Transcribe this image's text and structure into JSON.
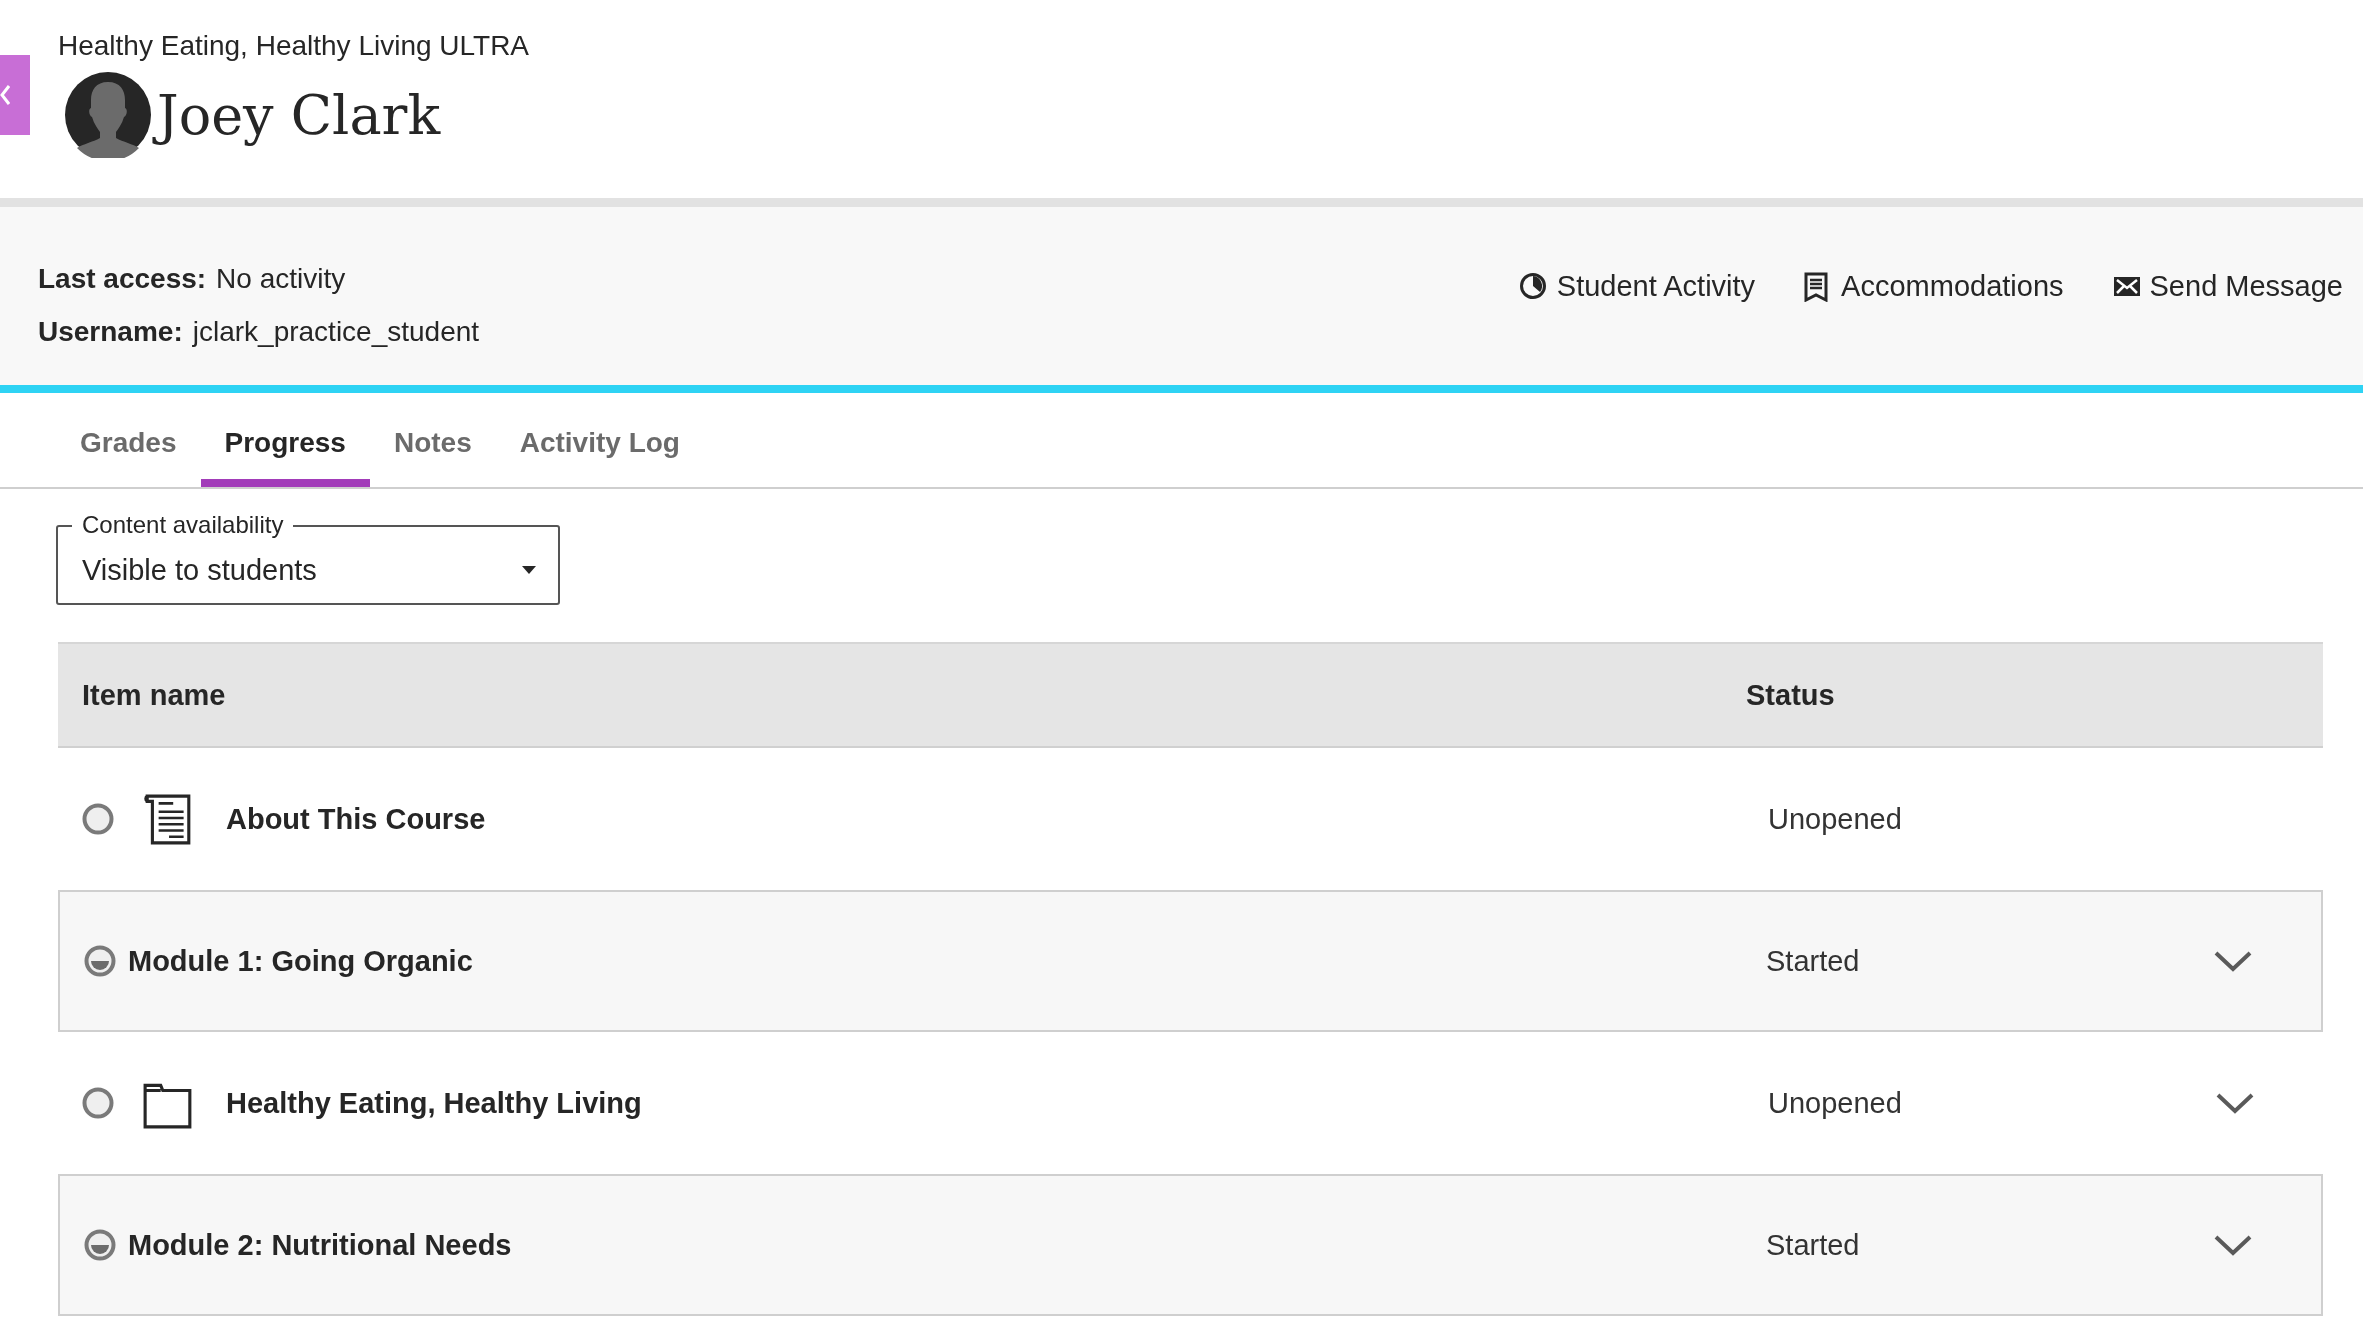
{
  "header": {
    "course_title": "Healthy Eating, Healthy Living ULTRA",
    "student_name": "Joey Clark"
  },
  "info": {
    "fields": [
      {
        "label": "Last access:",
        "value": "No activity"
      },
      {
        "label": "Username:",
        "value": "jclark_practice_student"
      }
    ],
    "actions": [
      {
        "kind": "activity",
        "label": "Student Activity"
      },
      {
        "kind": "accommodations",
        "label": "Accommodations"
      },
      {
        "kind": "message",
        "label": "Send Message"
      }
    ]
  },
  "tabs": [
    {
      "label": "Grades",
      "selected": false
    },
    {
      "label": "Progress",
      "selected": true
    },
    {
      "label": "Notes",
      "selected": false
    },
    {
      "label": "Activity Log",
      "selected": false
    }
  ],
  "filter": {
    "label": "Content availability",
    "value": "Visible to students"
  },
  "table": {
    "columns": [
      "Item name",
      "Status"
    ],
    "rows": [
      {
        "kind": "document",
        "started": false,
        "name": "About This Course",
        "status": "Unopened",
        "expandable": false
      },
      {
        "kind": "module",
        "started": true,
        "name": "Module 1: Going Organic",
        "status": "Started",
        "expandable": true
      },
      {
        "kind": "folder",
        "started": false,
        "name": "Healthy Eating, Healthy Living",
        "status": "Unopened",
        "expandable": true
      },
      {
        "kind": "module",
        "started": true,
        "name": "Module 2: Nutritional Needs",
        "status": "Started",
        "expandable": true
      }
    ]
  }
}
